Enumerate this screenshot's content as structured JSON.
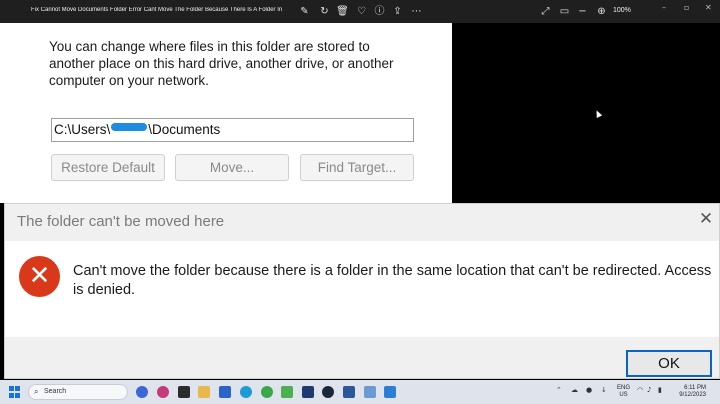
{
  "viewer": {
    "title": "Fix Cannot Move Documents Folder Error Cant Move The Folder Because There Is A Folder In the...",
    "zoom": "100%"
  },
  "properties": {
    "description": "You can change where files in this folder are stored to another place on this hard drive, another drive, or another computer on your network.",
    "path_prefix": "C:\\Users\\",
    "path_suffix": "\\Documents",
    "restore_label": "Restore Default",
    "move_label": "Move...",
    "find_label": "Find Target..."
  },
  "dialog": {
    "title": "The folder can't be moved here",
    "message": "Can't move the folder because there is a folder in the same location that can't be redirected. Access is denied.",
    "ok_label": "OK",
    "error_glyph": "✕",
    "close_glyph": "✕"
  },
  "taskbar": {
    "search_label": "Search",
    "lang_line1": "ENG",
    "lang_line2": "US",
    "time": "6:11 PM",
    "date": "9/12/2023"
  },
  "colors": {
    "accent": "#0a64c8",
    "error": "#d9391a",
    "redaction": "#1c8de0"
  }
}
